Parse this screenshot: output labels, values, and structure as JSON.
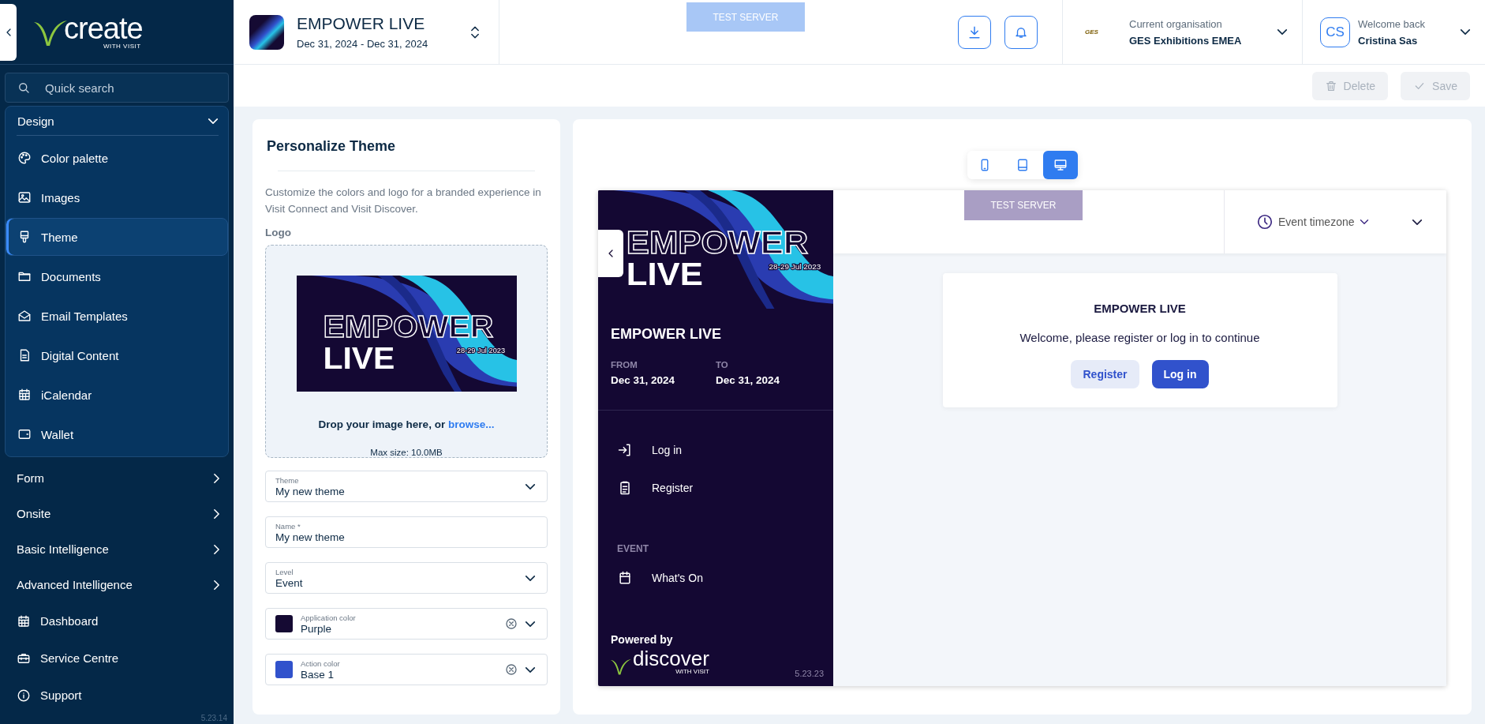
{
  "sidebar": {
    "logo": {
      "wordmark": "create",
      "tagline": "WITH VISIT"
    },
    "search": {
      "placeholder": "Quick search"
    },
    "nav": [
      {
        "kind": "group",
        "label": "Design",
        "expanded": true,
        "children": [
          {
            "label": "Color palette",
            "selected": false
          },
          {
            "label": "Images",
            "selected": false
          },
          {
            "label": "Theme",
            "selected": true
          },
          {
            "label": "Documents",
            "selected": false
          },
          {
            "label": "Email Templates",
            "selected": false
          },
          {
            "label": "Digital Content",
            "selected": false
          },
          {
            "label": "iCalendar",
            "selected": false
          },
          {
            "label": "Wallet",
            "selected": false
          }
        ]
      },
      {
        "kind": "group",
        "label": "Form",
        "expanded": false
      },
      {
        "kind": "group",
        "label": "Onsite",
        "expanded": false
      },
      {
        "kind": "group",
        "label": "Basic Intelligence",
        "expanded": false
      },
      {
        "kind": "group",
        "label": "Advanced Intelligence",
        "expanded": false
      },
      {
        "kind": "link",
        "label": "Dashboard",
        "selected": false
      },
      {
        "kind": "link",
        "label": "Service Centre",
        "selected": false
      },
      {
        "kind": "link",
        "label": "Support",
        "selected": false
      }
    ],
    "version": "5.23.14"
  },
  "topbar": {
    "event": {
      "title": "EMPOWER LIVE",
      "dates": "Dec 31, 2024 - Dec 31, 2024"
    },
    "server_badge": "TEST SERVER",
    "organisation": {
      "logo_text": "GES",
      "label": "Current organisation",
      "value": "GES Exhibitions EMEA"
    },
    "user": {
      "initials": "CS",
      "greeting": "Welcome back",
      "name": "Cristina Sas"
    }
  },
  "actions": [
    {
      "label": "Delete",
      "kind": "delete",
      "disabled": true
    },
    {
      "label": "Save",
      "kind": "save",
      "disabled": true
    }
  ],
  "theme_panel": {
    "title": "Personalize Theme",
    "description": "Customize the colors and logo for a branded experience in Visit Connect and Visit Discover.",
    "logo_label": "Logo",
    "logo_image": {
      "line_1": "EMPOWER",
      "line_2": "LIVE",
      "dates": "28-29 Jul 2023"
    },
    "drop_prompt": "Drop your image here, or",
    "browse_link": "browse...",
    "max_size": "Max size: 10.0MB",
    "fields": [
      {
        "kind": "select",
        "label": "Theme",
        "value": "My new theme"
      },
      {
        "kind": "text",
        "label": "Name *",
        "value": "My new theme"
      },
      {
        "kind": "select",
        "label": "Level",
        "value": "Event"
      },
      {
        "kind": "color",
        "label": "Application color",
        "value": "Purple",
        "color": "#150a33"
      },
      {
        "kind": "color",
        "label": "Action color",
        "value": "Base 1",
        "color": "#3152cc"
      }
    ]
  },
  "preview": {
    "devices": [
      {
        "kind": "phone",
        "selected": false
      },
      {
        "kind": "tablet",
        "selected": false
      },
      {
        "kind": "desktop",
        "selected": true
      }
    ],
    "server_badge": "TEST SERVER",
    "timezone": "Event timezone",
    "side": {
      "banner": {
        "line_1": "EMPOWER",
        "line_2": "LIVE",
        "dates": "28-29 Jul 2023"
      },
      "title": "EMPOWER LIVE",
      "from_label": "FROM",
      "from": "Dec 31, 2024",
      "to_label": "TO",
      "to": "Dec 31, 2024",
      "nav": [
        {
          "kind": "login",
          "label": "Log in"
        },
        {
          "kind": "register",
          "label": "Register"
        }
      ],
      "section": "EVENT",
      "section_items": [
        {
          "kind": "calendar",
          "label": "What's On"
        }
      ],
      "powered_by": "Powered by",
      "brand": "discover",
      "brand_tagline": "WITH VISIT",
      "version": "5.23.23"
    },
    "welcome": {
      "title": "EMPOWER LIVE",
      "message": "Welcome, please register or log in to continue",
      "buttons": [
        {
          "kind": "secondary",
          "label": "Register"
        },
        {
          "kind": "primary",
          "label": "Log in"
        }
      ]
    }
  }
}
